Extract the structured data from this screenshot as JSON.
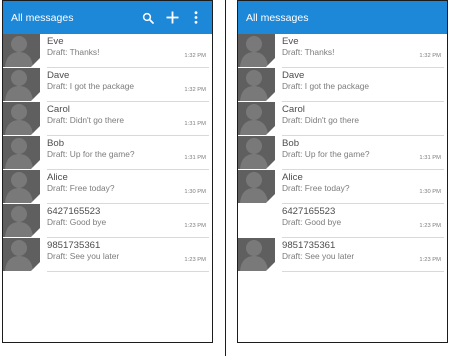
{
  "colors": {
    "app_bar": "#1e88d8",
    "app_bar_text": "#ffffff",
    "avatar_bg": "#5f5f5f",
    "text_primary": "#4d4d4d",
    "text_secondary": "#7c7c7c",
    "separator": "#d9d9d9"
  },
  "left_screen": {
    "title": "All messages",
    "actions": [
      {
        "name": "search",
        "icon": "search-icon"
      },
      {
        "name": "add",
        "icon": "plus-icon"
      },
      {
        "name": "overflow",
        "icon": "more-vert-icon"
      }
    ],
    "conversations": [
      {
        "name": "Eve",
        "draft": "Draft: Thanks!",
        "time": "1:32 PM",
        "avatar": true
      },
      {
        "name": "Dave",
        "draft": "Draft: I got the package",
        "time": "1:32 PM",
        "avatar": true
      },
      {
        "name": "Carol",
        "draft": "Draft: Didn't go there",
        "time": "1:31 PM",
        "avatar": true
      },
      {
        "name": "Bob",
        "draft": "Draft: Up for the game?",
        "time": "1:31 PM",
        "avatar": true
      },
      {
        "name": "Alice",
        "draft": "Draft: Free today?",
        "time": "1:30 PM",
        "avatar": true
      },
      {
        "name": "6427165523",
        "draft": "Draft: Good bye",
        "time": "1:23 PM",
        "avatar": true
      },
      {
        "name": "9851735361",
        "draft": "Draft: See you later",
        "time": "1:23 PM",
        "avatar": true
      }
    ]
  },
  "right_screen": {
    "title": "All messages",
    "conversations": [
      {
        "name": "Eve",
        "draft": "Draft: Thanks!",
        "time": "1:32 PM",
        "avatar": true
      },
      {
        "name": "Dave",
        "draft": "Draft: I got the package",
        "time": "",
        "avatar": true
      },
      {
        "name": "Carol",
        "draft": "Draft: Didn't go there",
        "time": "",
        "avatar": true
      },
      {
        "name": "Bob",
        "draft": "Draft: Up for the game?",
        "time": "1:31 PM",
        "avatar": true
      },
      {
        "name": "Alice",
        "draft": "Draft: Free today?",
        "time": "1:30 PM",
        "avatar": true
      },
      {
        "name": "6427165523",
        "draft": "Draft: Good bye",
        "time": "1:23 PM",
        "avatar": false
      },
      {
        "name": "9851735361",
        "draft": "Draft: See you later",
        "time": "1:23 PM",
        "avatar": true
      }
    ]
  }
}
